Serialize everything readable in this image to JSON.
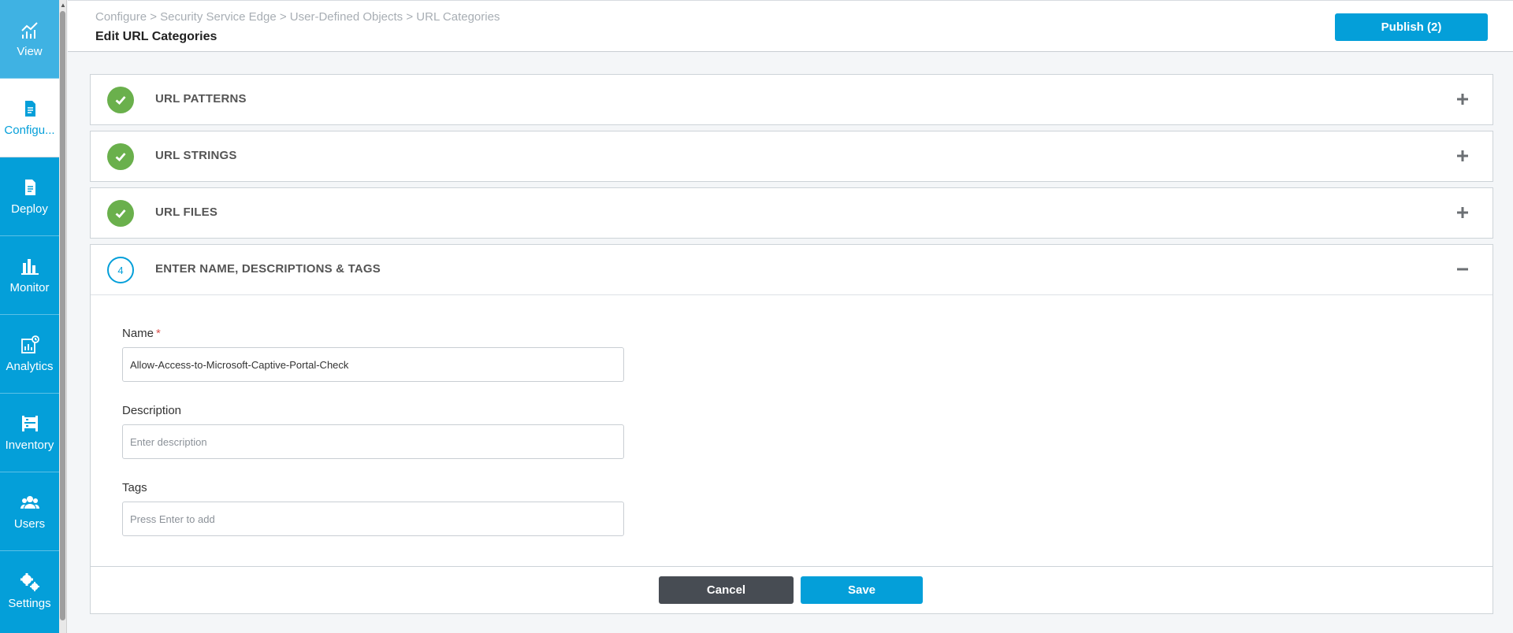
{
  "sidebar": {
    "items": [
      {
        "label": "View",
        "icon": "chart-line-icon"
      },
      {
        "label": "Configu...",
        "icon": "document-icon"
      },
      {
        "label": "Deploy",
        "icon": "document-icon"
      },
      {
        "label": "Monitor",
        "icon": "bar-chart-icon"
      },
      {
        "label": "Analytics",
        "icon": "analytics-icon"
      },
      {
        "label": "Inventory",
        "icon": "inventory-icon"
      },
      {
        "label": "Users",
        "icon": "users-icon"
      },
      {
        "label": "Settings",
        "icon": "gears-icon"
      }
    ],
    "active_index": 1
  },
  "header": {
    "breadcrumb": "Configure > Security Service Edge > User-Defined Objects > URL Categories",
    "title": "Edit URL Categories",
    "publish_label": "Publish (2)"
  },
  "panels": [
    {
      "title": "URL PATTERNS",
      "status": "complete"
    },
    {
      "title": "URL STRINGS",
      "status": "complete"
    },
    {
      "title": "URL FILES",
      "status": "complete"
    },
    {
      "title": "ENTER NAME, DESCRIPTIONS & TAGS",
      "status": "current",
      "step": "4"
    }
  ],
  "form": {
    "name_label": "Name",
    "name_required": "*",
    "name_value": "Allow-Access-to-Microsoft-Captive-Portal-Check",
    "description_label": "Description",
    "description_placeholder": "Enter description",
    "tags_label": "Tags",
    "tags_placeholder": "Press Enter to add"
  },
  "footer": {
    "cancel_label": "Cancel",
    "save_label": "Save"
  },
  "colors": {
    "sidebar": "#049fd9",
    "accent": "#049fd9",
    "success": "#6ab04c",
    "cancel": "#474c53"
  }
}
